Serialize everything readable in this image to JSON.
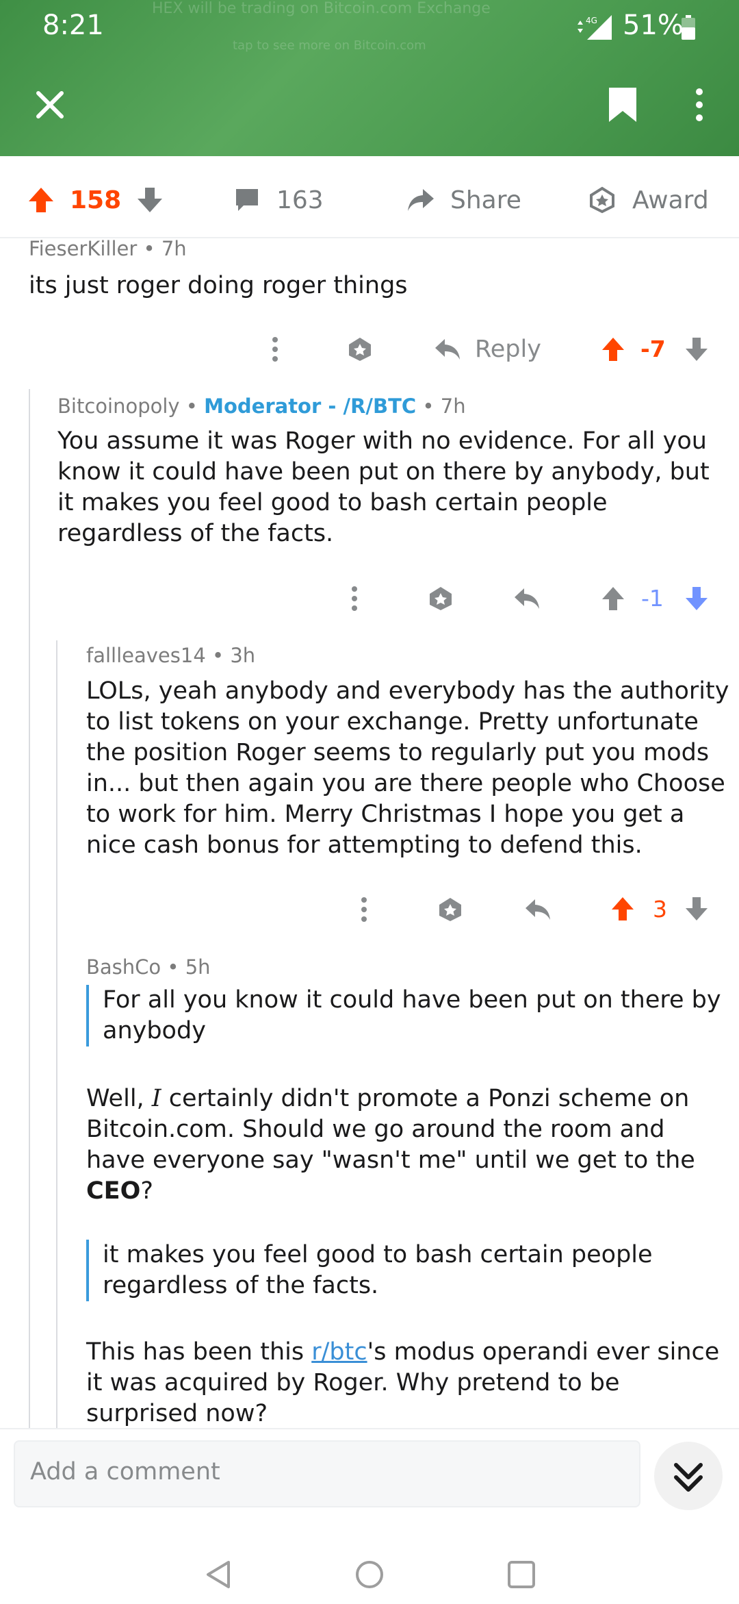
{
  "status_bar": {
    "time": "8:21",
    "network": "4G",
    "battery": "51%"
  },
  "header_banner_faded": [
    "HEX will be trading on Bitcoin.com Exchange",
    "tap to see more on Bitcoin.com"
  ],
  "post_actions": {
    "upvotes": "158",
    "comments": "163",
    "share_label": "Share",
    "award_label": "Award"
  },
  "comments": [
    {
      "author": "FieserKiller",
      "age": "7h",
      "body": "its just roger doing roger things",
      "reply_label": "Reply",
      "score": "-7"
    },
    {
      "author": "Bitcoinopoly",
      "flair": "Moderator - /R/BTC",
      "age": "7h",
      "body": "You assume it was Roger with no evidence. For all you know it could have been put on there by anybody, but it makes you feel good to bash certain people regardless of the facts.",
      "score": "-1"
    },
    {
      "author": "fallleaves14",
      "age": "3h",
      "body": "LOLs, yeah anybody and everybody has the authority to list tokens on your exchange. Pretty unfortunate the position Roger seems to regularly put you mods in... but then again you are there people who Choose to work for him. Merry Christmas I hope you get a nice cash bonus for attempting to defend this.",
      "score": "3"
    },
    {
      "author": "BashCo",
      "age": "5h",
      "quote1": "For all you know it could have been put on there by anybody",
      "para1_before": "Well, ",
      "para1_italic": "I",
      "para1_after": " certainly didn't promote a Ponzi scheme on Bitcoin.com. Should we go around the room and have everyone say \"wasn't me\" until we get to the ",
      "para1_bold": "CEO",
      "para1_end": "?",
      "quote2": "it makes you feel good to bash certain people regardless of the facts.",
      "para2_before": "This has been this ",
      "para2_link": "r/btc",
      "para2_after": "'s modus operandi ever since it was acquired by Roger. Why pretend to be surprised now?"
    }
  ],
  "comment_input": {
    "placeholder": "Add a comment"
  },
  "colors": {
    "upvote": "#ff4500",
    "downvote": "#7193ff",
    "neutral": "#878a8c",
    "moderator": "#2f9bd8",
    "header_green": "#4b9b50"
  }
}
